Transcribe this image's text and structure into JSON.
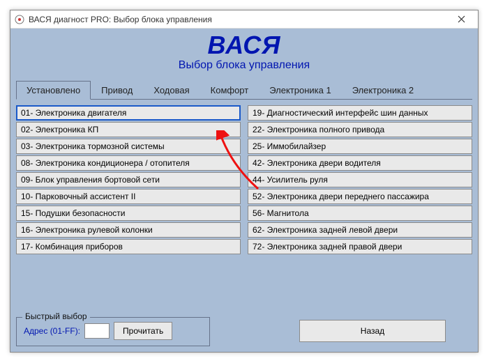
{
  "window": {
    "title": "ВАСЯ диагност PRO:  Выбор блока управления"
  },
  "brand": {
    "title": "ВАСЯ",
    "subtitle": "Выбор блока управления"
  },
  "tabs": [
    {
      "label": "Установлено",
      "active": true
    },
    {
      "label": "Привод"
    },
    {
      "label": "Ходовая"
    },
    {
      "label": "Комфорт"
    },
    {
      "label": "Электроника 1"
    },
    {
      "label": "Электроника 2"
    }
  ],
  "columns": {
    "left": [
      "01- Электроника двигателя",
      "02- Электроника КП",
      "03- Электроника тормозной системы",
      "08- Электроника кондиционера / отопителя",
      "09- Блок управления бортовой сети",
      "10- Парковочный ассистент II",
      "15- Подушки безопасности",
      "16- Электроника рулевой колонки",
      "17- Комбинация приборов"
    ],
    "right": [
      "19- Диагностический интерфейс шин данных",
      "22- Электроника полного привода",
      "25- Иммобилайзер",
      "42- Электроника двери водителя",
      "44- Усилитель руля",
      "52- Электроника двери переднего пассажира",
      "56- Магнитола",
      "62- Электроника задней левой двери",
      "72- Электроника задней правой двери"
    ]
  },
  "quick": {
    "legend": "Быстрый выбор",
    "address_label": "Адрес (01-FF):",
    "address_value": "",
    "read_label": "Прочитать"
  },
  "back_label": "Назад",
  "colors": {
    "accent": "#0015b0",
    "panel": "#a9bdd6",
    "arrow": "#e11"
  }
}
